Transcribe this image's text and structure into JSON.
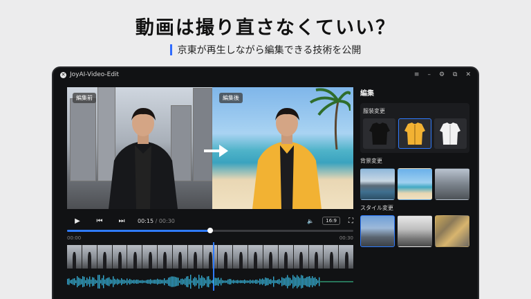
{
  "headline": "動画は撮り直さなくていい？",
  "subline": "京東が再生しながら編集できる技術を公開",
  "window": {
    "title": "JoyAI-Video-Edit",
    "logo_glyph": "✕",
    "controls": [
      "≡",
      "–",
      "⚙",
      "⧉",
      "✕"
    ]
  },
  "preview": {
    "before_label": "編集前",
    "after_label": "編集後"
  },
  "player": {
    "current_time": "00:15",
    "separator": " / ",
    "total_time": "00:30",
    "aspect_ratio": "16:9",
    "progress_fraction": 0.5,
    "tick_start": "00:00",
    "tick_end": "00:30"
  },
  "panel": {
    "title": "編集",
    "sections": [
      {
        "title": "服装変更",
        "items": [
          "black-jacket",
          "yellow-jacket",
          "white-jacket"
        ],
        "selected": 1
      },
      {
        "title": "背景変更",
        "items": [
          "mountain-lake",
          "beach",
          "city-street"
        ],
        "selected": -1
      },
      {
        "title": "スタイル変更",
        "items": [
          "realistic-city",
          "monochrome-city",
          "oil-painting"
        ],
        "selected": 0
      }
    ]
  },
  "colors": {
    "accent": "#2f7bff",
    "wave_start": "#2a7bff",
    "wave_end": "#3fd9a0",
    "yellow_jacket": "#f2b233"
  }
}
